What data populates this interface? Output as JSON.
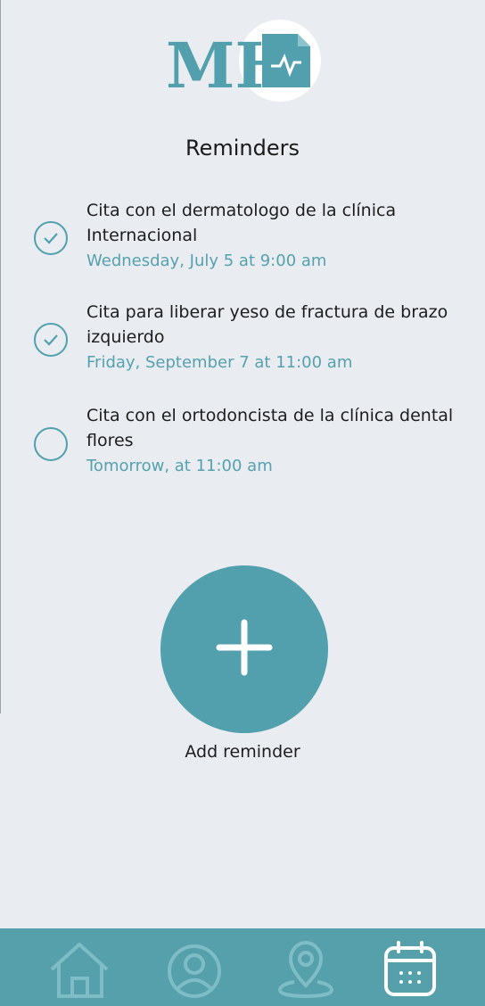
{
  "app": {
    "logo_text": "MH",
    "accent_color": "#52a0ad",
    "nav_bar_color": "#55a0aa",
    "background_color": "#e9ecf1"
  },
  "page": {
    "title": "Reminders"
  },
  "reminders": [
    {
      "title": "Cita con el dermatologo de la clínica Internacional",
      "time": "Wednesday, July 5 at 9:00 am",
      "completed": true
    },
    {
      "title": "Cita para liberar yeso de fractura de brazo izquierdo",
      "time": "Friday, September 7 at 11:00 am",
      "completed": true
    },
    {
      "title": "Cita con el ortodoncista de la clínica dental flores",
      "time": "Tomorrow, at 11:00 am",
      "completed": false
    }
  ],
  "add_reminder": {
    "label": "Add reminder",
    "icon": "plus-icon"
  },
  "bottom_nav": {
    "items": [
      {
        "icon": "home-icon",
        "active": false
      },
      {
        "icon": "profile-icon",
        "active": false
      },
      {
        "icon": "location-icon",
        "active": false
      },
      {
        "icon": "calendar-icon",
        "active": true
      }
    ]
  }
}
